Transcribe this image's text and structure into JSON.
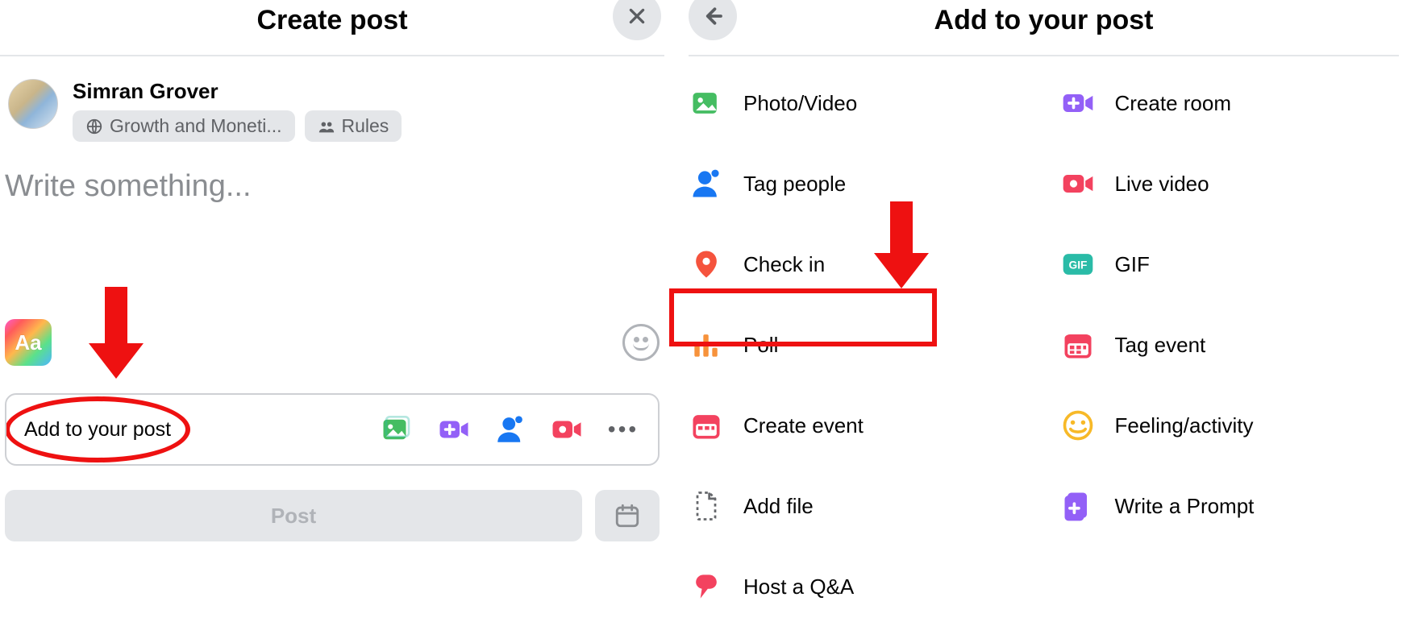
{
  "left": {
    "title": "Create post",
    "author_name": "Simran Grover",
    "chip_group": "Growth and Moneti...",
    "chip_rules": "Rules",
    "composer_placeholder": "Write something...",
    "bg_picker_label": "Aa",
    "add_label": "Add to your post",
    "post_button": "Post"
  },
  "right": {
    "title": "Add to your post",
    "options": {
      "photo_video": "Photo/Video",
      "create_room": "Create room",
      "tag_people": "Tag people",
      "live_video": "Live video",
      "check_in": "Check in",
      "gif": "GIF",
      "poll": "Poll",
      "tag_event": "Tag event",
      "create_event": "Create event",
      "feeling_activity": "Feeling/activity",
      "add_file": "Add file",
      "write_prompt": "Write a Prompt",
      "host_qa": "Host a Q&A"
    }
  },
  "gif_badge": "GIF"
}
